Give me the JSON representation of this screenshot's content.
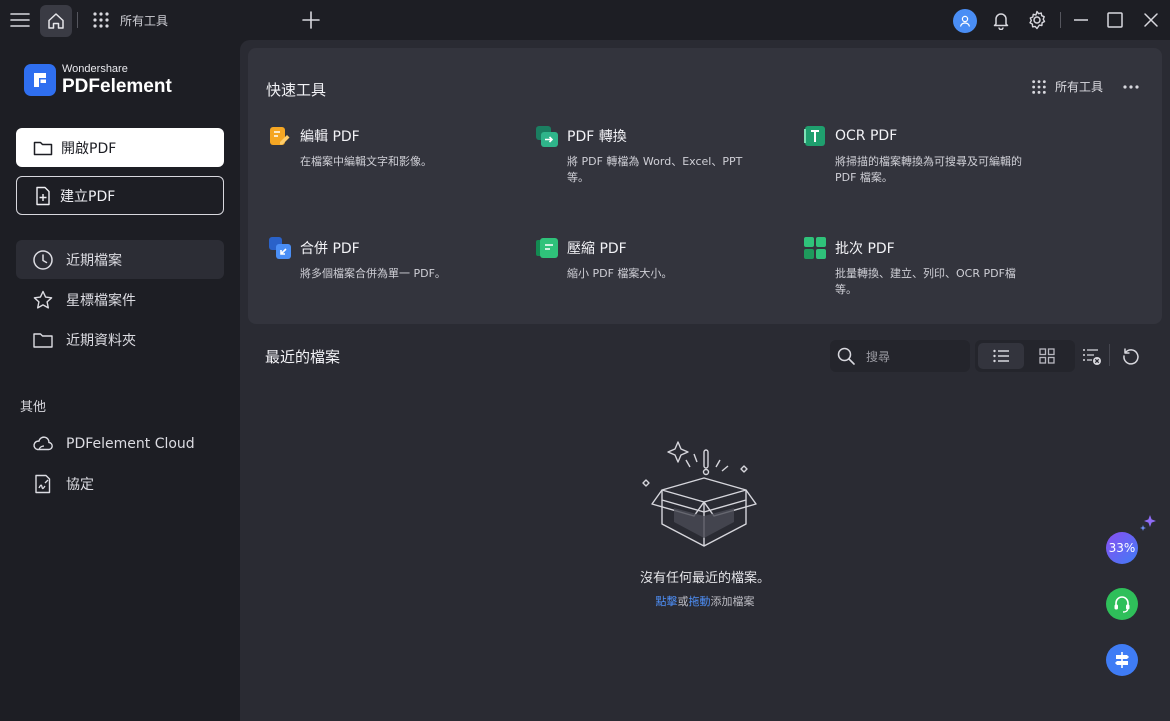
{
  "titlebar": {
    "all_tools_label": "所有工具"
  },
  "logo": {
    "brand_small": "Wondershare",
    "brand_big": "PDFelement"
  },
  "sidebar": {
    "open_label": "開啟PDF",
    "create_label": "建立PDF",
    "nav": [
      {
        "label": "近期檔案",
        "icon": "clock-icon"
      },
      {
        "label": "星標檔案件",
        "icon": "star-icon"
      },
      {
        "label": "近期資料夾",
        "icon": "folder-icon"
      }
    ],
    "section_other": "其他",
    "other_items": [
      {
        "label": "PDFelement Cloud",
        "icon": "cloud-icon"
      },
      {
        "label": "協定",
        "icon": "agreement-icon"
      }
    ]
  },
  "quick_tools": {
    "title": "快速工具",
    "all_tools_label": "所有工具",
    "tools": [
      {
        "name": "編輯 PDF",
        "desc": "在檔案中編輯文字和影像。",
        "icon": "edit-pdf-icon"
      },
      {
        "name": "PDF 轉換",
        "desc": "將 PDF 轉檔為 Word、Excel、PPT 等。",
        "icon": "convert-pdf-icon"
      },
      {
        "name": "OCR PDF",
        "desc": "將掃描的檔案轉換為可搜尋及可編輯的 PDF 檔案。",
        "icon": "ocr-pdf-icon"
      },
      {
        "name": "合併 PDF",
        "desc": "將多個檔案合併為單一 PDF。",
        "icon": "merge-pdf-icon"
      },
      {
        "name": "壓縮 PDF",
        "desc": "縮小 PDF 檔案大小。",
        "icon": "compress-pdf-icon"
      },
      {
        "name": "批次 PDF",
        "desc": "批量轉換、建立、列印、OCR PDF檔等。",
        "icon": "batch-pdf-icon"
      }
    ]
  },
  "recent": {
    "title": "最近的檔案",
    "search_placeholder": "搜尋",
    "empty_text": "沒有任何最近的檔案。",
    "hint_click": "點擊",
    "hint_or": "或",
    "hint_drag": "拖動",
    "hint_rest": "添加檔案"
  },
  "floating": {
    "ai_label": "33%"
  },
  "colors": {
    "background": "#1d1e24",
    "main": "#2a2b33",
    "panel": "#33343d",
    "accent": "#4e8ff7",
    "brand": "#2f6ff0",
    "edit": "#f5a623",
    "convert": "#27a37a",
    "ocr": "#1f9f6e",
    "merge": "#3b7df0",
    "compress": "#22b36c",
    "batch": "#2aaf62"
  }
}
